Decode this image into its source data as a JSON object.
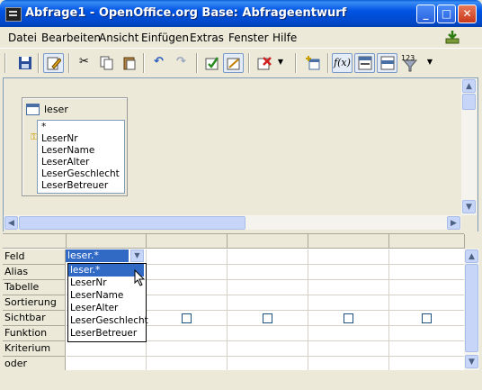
{
  "window": {
    "title": "Abfrage1 - OpenOffice.org Base: Abfrageentwurf",
    "controls": {
      "minimize": "_",
      "maximize": "□",
      "close": "✕"
    }
  },
  "menu": [
    "Datei",
    "Bearbeiten",
    "Ansicht",
    "Einfügen",
    "Extras",
    "Fenster",
    "Hilfe"
  ],
  "toolbar": {
    "icons": [
      "save-icon",
      "edit-icon",
      "cut-icon",
      "copy-icon",
      "paste-icon",
      "undo-icon",
      "redo-icon",
      "run-query-icon",
      "clear-query-icon",
      "design-view-icon",
      "delete-icon",
      "add-table-icon",
      "functions-icon",
      "table-name-icon",
      "alias-icon",
      "distinct-values-icon"
    ],
    "functions_label": "f(x)",
    "distinct_label": "123"
  },
  "table_window": {
    "name": "leser",
    "fields": [
      "*",
      "LeserNr",
      "LeserName",
      "LeserAlter",
      "LeserGeschlecht",
      "LeserBetreuer"
    ],
    "primary_key": "LeserNr"
  },
  "grid": {
    "row_labels": [
      "Feld",
      "Alias",
      "Tabelle",
      "Sortierung",
      "Sichtbar",
      "Funktion",
      "Kriterium",
      "oder"
    ],
    "field_value": "leser.*",
    "dropdown_options": [
      "leser.*",
      "LeserNr",
      "LeserName",
      "LeserAlter",
      "LeserGeschlecht",
      "LeserBetreuer"
    ],
    "selected_option": "leser.*"
  },
  "colors": {
    "title_bar": "#0054e3",
    "selection": "#316ac5",
    "background": "#ece9d8"
  }
}
